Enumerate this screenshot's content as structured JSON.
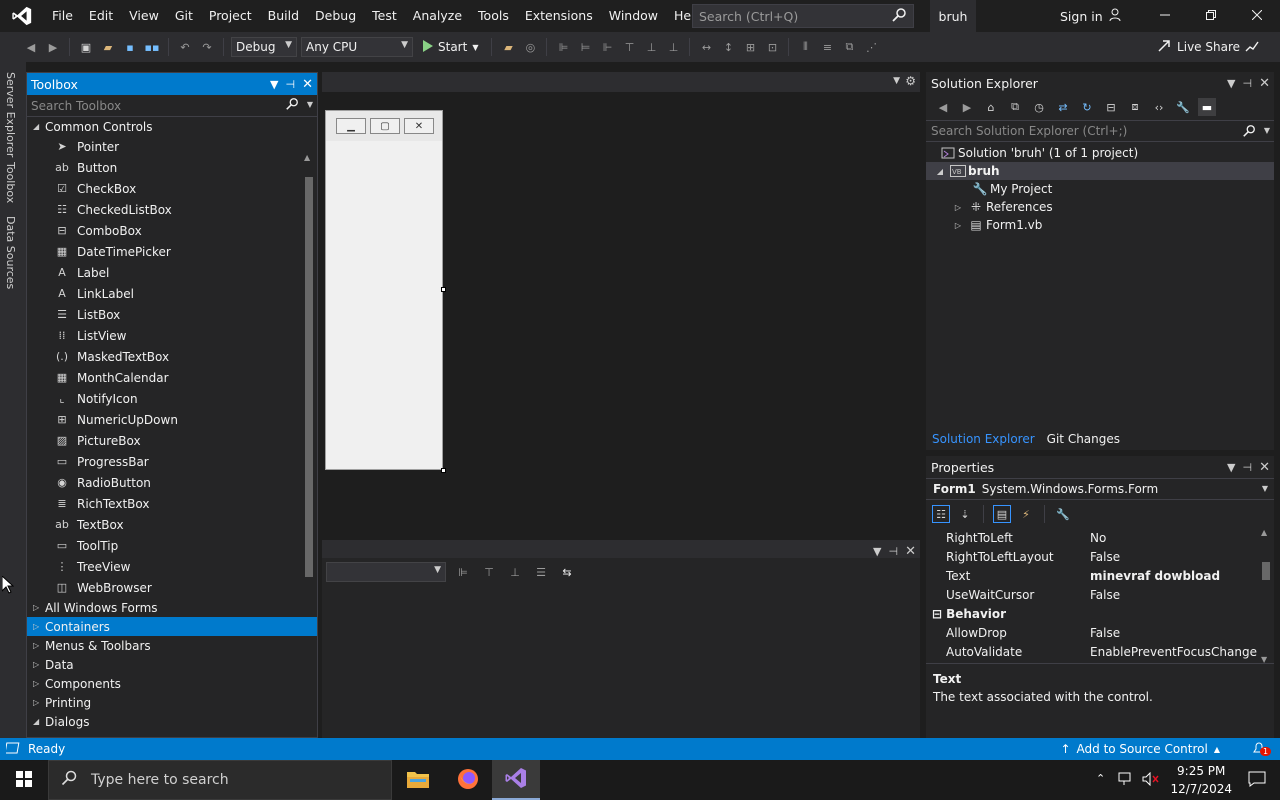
{
  "menu": [
    "File",
    "Edit",
    "View",
    "Git",
    "Project",
    "Build",
    "Debug",
    "Test",
    "Analyze",
    "Tools",
    "Extensions",
    "Window",
    "Help"
  ],
  "search": {
    "placeholder": "Search (Ctrl+Q)"
  },
  "solution_name": "bruh",
  "signin": "Sign in",
  "toolbar": {
    "config": "Debug",
    "platform": "Any CPU",
    "start": "Start",
    "live_share": "Live Share"
  },
  "side_tabs": [
    "Server Explorer",
    "Toolbox",
    "Data Sources"
  ],
  "toolbox": {
    "title": "Toolbox",
    "search_placeholder": "Search Toolbox",
    "common_group": "Common Controls",
    "items": [
      {
        "label": "Pointer",
        "icon": "pointer-icon"
      },
      {
        "label": "Button",
        "icon": "button-icon"
      },
      {
        "label": "CheckBox",
        "icon": "checkbox-icon"
      },
      {
        "label": "CheckedListBox",
        "icon": "checkedlistbox-icon"
      },
      {
        "label": "ComboBox",
        "icon": "combobox-icon"
      },
      {
        "label": "DateTimePicker",
        "icon": "datetimepicker-icon"
      },
      {
        "label": "Label",
        "icon": "label-icon"
      },
      {
        "label": "LinkLabel",
        "icon": "linklabel-icon"
      },
      {
        "label": "ListBox",
        "icon": "listbox-icon"
      },
      {
        "label": "ListView",
        "icon": "listview-icon"
      },
      {
        "label": "MaskedTextBox",
        "icon": "maskedtextbox-icon"
      },
      {
        "label": "MonthCalendar",
        "icon": "monthcalendar-icon"
      },
      {
        "label": "NotifyIcon",
        "icon": "notifyicon-icon"
      },
      {
        "label": "NumericUpDown",
        "icon": "numericupdown-icon"
      },
      {
        "label": "PictureBox",
        "icon": "picturebox-icon"
      },
      {
        "label": "ProgressBar",
        "icon": "progressbar-icon"
      },
      {
        "label": "RadioButton",
        "icon": "radiobutton-icon"
      },
      {
        "label": "RichTextBox",
        "icon": "richtextbox-icon"
      },
      {
        "label": "TextBox",
        "icon": "textbox-icon"
      },
      {
        "label": "ToolTip",
        "icon": "tooltip-icon"
      },
      {
        "label": "TreeView",
        "icon": "treeview-icon"
      },
      {
        "label": "WebBrowser",
        "icon": "webbrowser-icon"
      }
    ],
    "groups": [
      "All Windows Forms",
      "Containers",
      "Menus & Toolbars",
      "Data",
      "Components",
      "Printing",
      "Dialogs"
    ],
    "selected_group": "Containers"
  },
  "solution_explorer": {
    "title": "Solution Explorer",
    "search_placeholder": "Search Solution Explorer (Ctrl+;)",
    "solution": "Solution 'bruh' (1 of 1 project)",
    "project": "bruh",
    "nodes": [
      "My Project",
      "References",
      "Form1.vb"
    ],
    "tabs": [
      "Solution Explorer",
      "Git Changes"
    ]
  },
  "properties": {
    "title": "Properties",
    "object_name": "Form1",
    "object_type": "System.Windows.Forms.Form",
    "rows": [
      {
        "name": "RightToLeft",
        "value": "No"
      },
      {
        "name": "RightToLeftLayout",
        "value": "False"
      },
      {
        "name": "Text",
        "value": "minevraf dowbload"
      },
      {
        "name": "UseWaitCursor",
        "value": "False"
      }
    ],
    "category": "Behavior",
    "rows2": [
      {
        "name": "AllowDrop",
        "value": "False"
      },
      {
        "name": "AutoValidate",
        "value": "EnablePreventFocusChange"
      }
    ],
    "desc_title": "Text",
    "desc_text": "The text associated with the control."
  },
  "status": {
    "ready": "Ready",
    "source_control": "Add to Source Control",
    "notifications": "1"
  },
  "taskbar": {
    "search_placeholder": "Type here to search",
    "time": "9:25 PM",
    "date": "12/7/2024"
  },
  "colors": {
    "accent": "#007acc",
    "background": "#1e1e1e",
    "panel": "#252526"
  }
}
